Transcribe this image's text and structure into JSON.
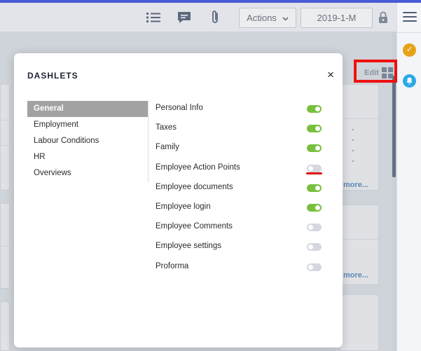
{
  "toolbar": {
    "actions_label": "Actions",
    "period_value": "2019-1-M"
  },
  "icons": {
    "list": "list-icon",
    "comment": "comment-icon",
    "attach": "paperclip-icon",
    "chevron": "chevron-down-icon",
    "lock": "lock-icon",
    "menu": "hamburger-menu-icon",
    "check": "check-badge-icon",
    "bell": "notification-icon",
    "grid": "grid-icon"
  },
  "dashboard": {
    "edit_label": "Edit",
    "more_label": "more...",
    "dash_values": [
      "-",
      "-",
      "-",
      "-"
    ]
  },
  "modal": {
    "title": "DASHLETS",
    "close_label": "×",
    "tabs": [
      {
        "label": "General",
        "active": true
      },
      {
        "label": "Employment",
        "active": false
      },
      {
        "label": "Labour Conditions",
        "active": false
      },
      {
        "label": "HR",
        "active": false
      },
      {
        "label": "Overviews",
        "active": false
      }
    ],
    "options": [
      {
        "label": "Personal Info",
        "enabled": true
      },
      {
        "label": "Taxes",
        "enabled": true
      },
      {
        "label": "Family",
        "enabled": true
      },
      {
        "label": "Employee Action Points",
        "enabled": false
      },
      {
        "label": "Employee documents",
        "enabled": true
      },
      {
        "label": "Employee login",
        "enabled": true
      },
      {
        "label": "Employee Comments",
        "enabled": false
      },
      {
        "label": "Employee settings",
        "enabled": false
      },
      {
        "label": "Proforma",
        "enabled": false
      }
    ]
  },
  "colors": {
    "accent_bar": "#4a5bd6",
    "toggle_on": "#78bf3d",
    "toggle_off": "#d4d8de",
    "highlight_red": "#ee1111",
    "badge_check": "#e7a317",
    "badge_bell": "#2aa9e8"
  }
}
